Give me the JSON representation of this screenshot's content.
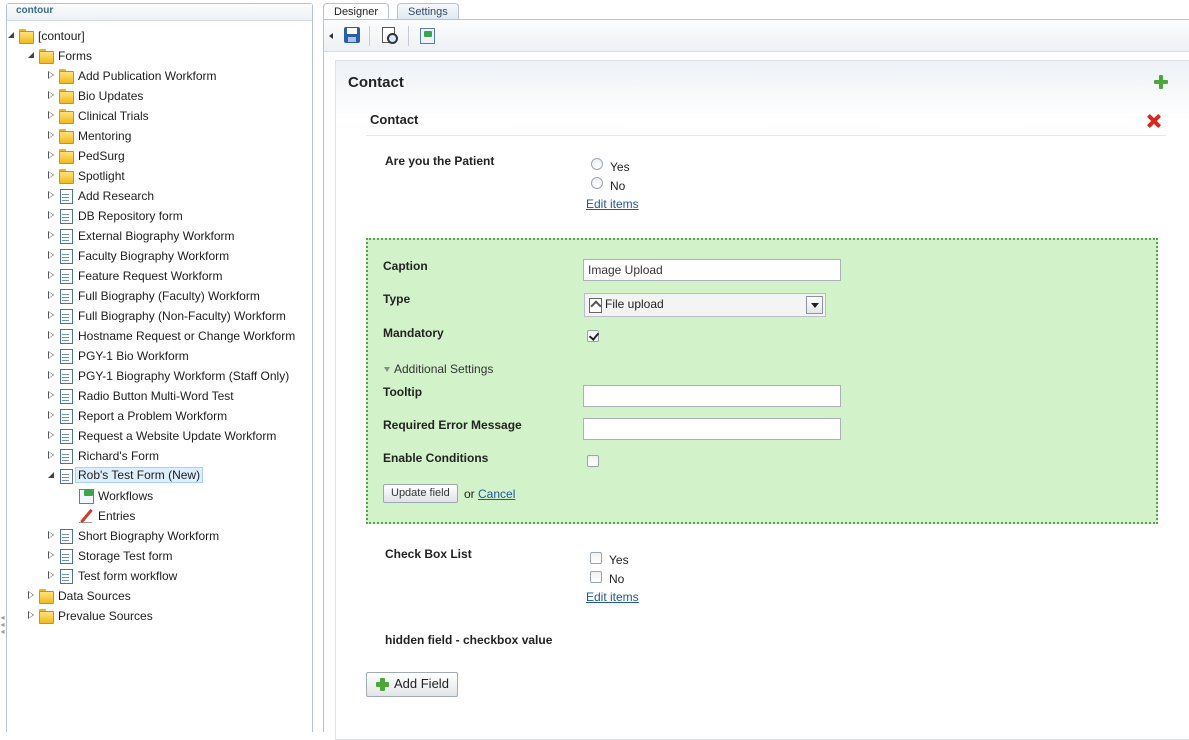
{
  "tree": {
    "header": "contour",
    "root": "[contour]",
    "forms_label": "Forms",
    "form_items": [
      {
        "label": "Add Publication Workform",
        "kind": "folder"
      },
      {
        "label": "Bio Updates",
        "kind": "folder"
      },
      {
        "label": "Clinical Trials",
        "kind": "folder"
      },
      {
        "label": "Mentoring",
        "kind": "folder"
      },
      {
        "label": "PedSurg",
        "kind": "folder"
      },
      {
        "label": "Spotlight",
        "kind": "folder"
      },
      {
        "label": "Add Research",
        "kind": "form"
      },
      {
        "label": "DB Repository form",
        "kind": "form"
      },
      {
        "label": "External Biography Workform",
        "kind": "form"
      },
      {
        "label": "Faculty Biography Workform",
        "kind": "form"
      },
      {
        "label": "Feature Request Workform",
        "kind": "form"
      },
      {
        "label": "Full Biography (Faculty) Workform",
        "kind": "form"
      },
      {
        "label": "Full Biography (Non-Faculty) Workform",
        "kind": "form"
      },
      {
        "label": "Hostname Request or Change Workform",
        "kind": "form"
      },
      {
        "label": "PGY-1 Bio Workform",
        "kind": "form"
      },
      {
        "label": "PGY-1 Biography Workform (Staff Only)",
        "kind": "form"
      },
      {
        "label": "Radio Button Multi-Word Test",
        "kind": "form"
      },
      {
        "label": "Report a Problem Workform",
        "kind": "form"
      },
      {
        "label": "Request a Website Update Workform",
        "kind": "form"
      },
      {
        "label": "Richard's Form",
        "kind": "form"
      }
    ],
    "selected_form": "Rob's Test Form (New)",
    "selected_children": [
      "Workflows",
      "Entries"
    ],
    "after_items": [
      "Short Biography Workform",
      "Storage Test form",
      "Test form workflow"
    ],
    "data_sources": "Data Sources",
    "prevalue_sources": "Prevalue Sources"
  },
  "tabs": [
    "Designer",
    "Settings"
  ],
  "designer": {
    "page_title": "Contact",
    "fieldset_title": "Contact",
    "patient_field": {
      "label": "Are you the Patient",
      "options": [
        "Yes",
        "No"
      ],
      "edit_link": "Edit items"
    },
    "edit_box": {
      "caption_label": "Caption",
      "caption_value": "Image Upload",
      "type_label": "Type",
      "type_value": "File upload",
      "mandatory_label": "Mandatory",
      "mandatory_checked": true,
      "additional_settings": "Additional Settings",
      "tooltip_label": "Tooltip",
      "tooltip_value": "",
      "required_error_label": "Required Error Message",
      "required_error_value": "",
      "enable_conditions_label": "Enable Conditions",
      "enable_conditions_checked": false,
      "update_button": "Update field",
      "or_text": "or",
      "cancel_link": "Cancel"
    },
    "checkbox_field": {
      "label": "Check Box List",
      "options": [
        "Yes",
        "No"
      ],
      "edit_link": "Edit items"
    },
    "hidden_field_label": "hidden field - checkbox value",
    "add_field_button": "Add Field"
  },
  "colors": {
    "edit_box_bg": "#d2f2c9",
    "edit_box_border": "#58a34c",
    "link": "#1f56a3",
    "add_icon": "#4aa83a",
    "delete_icon": "#d8281e"
  }
}
